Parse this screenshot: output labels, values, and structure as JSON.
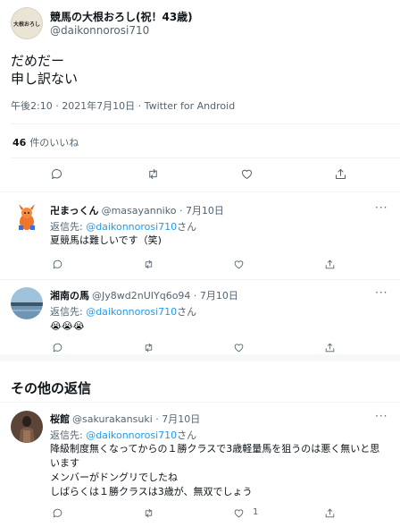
{
  "main_tweet": {
    "avatar_text": "大根おろし",
    "name": "競馬の大根おろし(祝！43歳)",
    "handle": "@daikonnorosi710",
    "text": "だめだー\n申し訳ない",
    "meta": "午後2:10 · 2021年7月10日 · Twitter for Android",
    "likes_count": "46",
    "likes_label": "件のいいね"
  },
  "replies": [
    {
      "name": "卍まっくん",
      "handle": "@masayanniko · 7月10日",
      "reply_prefix": "返信先: ",
      "reply_target": "@daikonnorosi710",
      "reply_suffix": "さん",
      "text": "夏競馬は難しいです（笑)",
      "like_count": ""
    },
    {
      "name": "湘南の馬",
      "handle": "@Jy8wd2nUIYq6o94 · 7月10日",
      "reply_prefix": "返信先: ",
      "reply_target": "@daikonnorosi710",
      "reply_suffix": "さん",
      "text": "😭😭😭",
      "like_count": ""
    },
    {
      "name": "桜館",
      "handle": "@sakurakansuki · 7月10日",
      "reply_prefix": "返信先: ",
      "reply_target": "@daikonnorosi710",
      "reply_suffix": "さん",
      "text": "降級制度無くなってからの１勝クラスで3歳軽量馬を狙うのは悪く無いと思います\nメンバーがドングリでしたね\nしばらくは１勝クラスは3歳が、無双でしょう",
      "like_count": "1"
    }
  ],
  "other_replies_title": "その他の返信",
  "icons": [
    "reply-icon",
    "retweet-icon",
    "like-icon",
    "share-icon",
    "more-icon"
  ],
  "colors": {
    "link": "#1d9bf0",
    "secondary": "#536471",
    "divider": "#eff3f4"
  }
}
